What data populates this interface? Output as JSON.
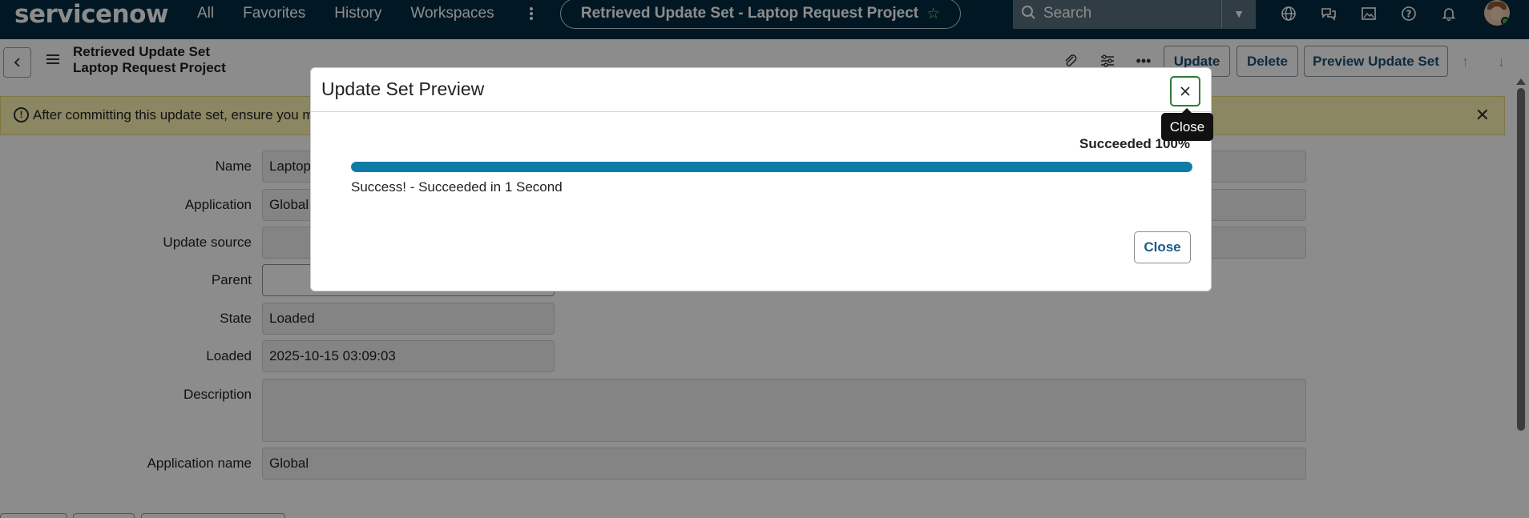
{
  "topnav": {
    "logo": "servicenow",
    "items": [
      "All",
      "Favorites",
      "History",
      "Workspaces"
    ],
    "pill_title": "Retrieved Update Set - Laptop Request Project",
    "search_placeholder": "Search"
  },
  "header": {
    "title_line1": "Retrieved Update Set",
    "title_line2": "Laptop Request Project",
    "buttons": {
      "update": "Update",
      "delete": "Delete",
      "preview": "Preview Update Set"
    }
  },
  "banner": {
    "text": "After committing this update set, ensure you m"
  },
  "form": {
    "name_label": "Name",
    "name_value": "Laptop",
    "application_label": "Application",
    "application_value": "Global",
    "update_source_label": "Update source",
    "update_source_value": "",
    "parent_label": "Parent",
    "parent_value": "",
    "state_label": "State",
    "state_value": "Loaded",
    "loaded_label": "Loaded",
    "loaded_value": "2025-10-15 03:09:03",
    "description_label": "Description",
    "description_value": "",
    "application_name_label": "Application name",
    "application_name_value": "Global"
  },
  "modal": {
    "title": "Update Set Preview",
    "close_tooltip": "Close",
    "progress_label": "Succeeded 100%",
    "progress_percent": 100,
    "message": "Success! - Succeeded in 1 Second",
    "close_button": "Close"
  },
  "colors": {
    "nav_bg": "#032d42",
    "progress": "#0f7ca6",
    "banner_bg": "#fdf6b5",
    "focus_ring": "#2e7d32"
  }
}
